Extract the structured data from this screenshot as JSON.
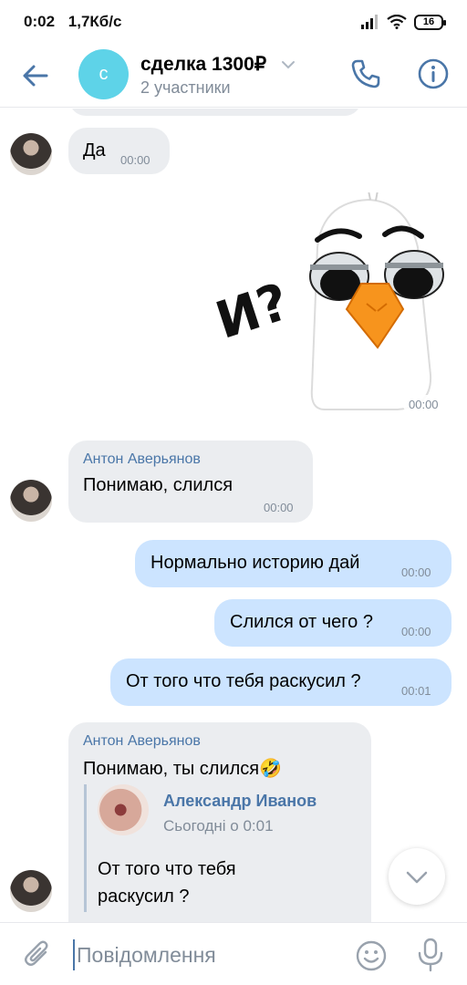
{
  "status": {
    "time": "0:02",
    "speed": "1,7Кб/с",
    "battery": "16"
  },
  "header": {
    "title": "сделка 1300₽",
    "subtitle": "2 участники",
    "avatar_letter": "с"
  },
  "messages": [
    {
      "type": "in",
      "text": "Да",
      "time": "00:00"
    },
    {
      "type": "sticker",
      "caption": "И?",
      "time": "00:00"
    },
    {
      "type": "in",
      "sender": "Антон Аверьянов",
      "text": "Понимаю, слился",
      "time": "00:00"
    },
    {
      "type": "out",
      "text": "Нормально историю дай",
      "time": "00:00"
    },
    {
      "type": "out",
      "text": "Слился от чего ?",
      "time": "00:00"
    },
    {
      "type": "out",
      "text": "От того что тебя раскусил ?",
      "time": "00:01"
    },
    {
      "type": "in",
      "sender": "Антон Аверьянов",
      "text": "Понимаю, ты слился🤣",
      "reply": {
        "name": "Александр Иванов",
        "date": "Сьогодні о 0:01",
        "text_line1": "От того что тебя",
        "text_line2": "раскусил ?"
      }
    }
  ],
  "composer": {
    "placeholder": "Повідомлення"
  },
  "colors": {
    "accent": "#4a76a8",
    "in_bubble": "#ebedf0",
    "out_bubble": "#cce4ff",
    "avatar_bg": "#5ed3e8"
  }
}
